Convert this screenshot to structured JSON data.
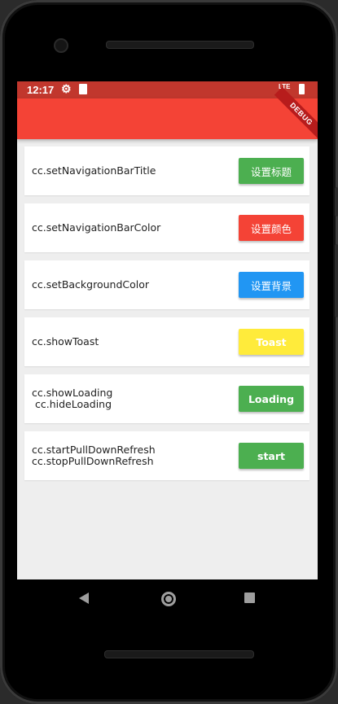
{
  "status_bar": {
    "time": "12:17",
    "network": "LTE",
    "settings_icon": "gear-icon",
    "sd_icon": "sd-card-icon",
    "battery_icon": "battery-icon"
  },
  "app_bar": {
    "color": "#f44336",
    "debug_banner": "DEBUG"
  },
  "items": [
    {
      "label": "cc.setNavigationBarTitle",
      "button": "设置标题",
      "color": "#4caf50"
    },
    {
      "label": "cc.setNavigationBarColor",
      "button": "设置颜色",
      "color": "#f44336"
    },
    {
      "label": "cc.setBackgroundColor",
      "button": "设置背景",
      "color": "#2196f3"
    },
    {
      "label": "cc.showToast",
      "button": "Toast",
      "color": "#ffeb3b"
    },
    {
      "label": "cc.showLoading\n cc.hideLoading",
      "button": "Loading",
      "color": "#4caf50"
    },
    {
      "label": "cc.startPullDownRefresh\ncc.stopPullDownRefresh",
      "button": "start",
      "color": "#4caf50"
    }
  ],
  "nav_bar": {
    "back_icon": "back-triangle-icon",
    "home_icon": "home-circle-icon",
    "recents_icon": "recents-square-icon"
  }
}
